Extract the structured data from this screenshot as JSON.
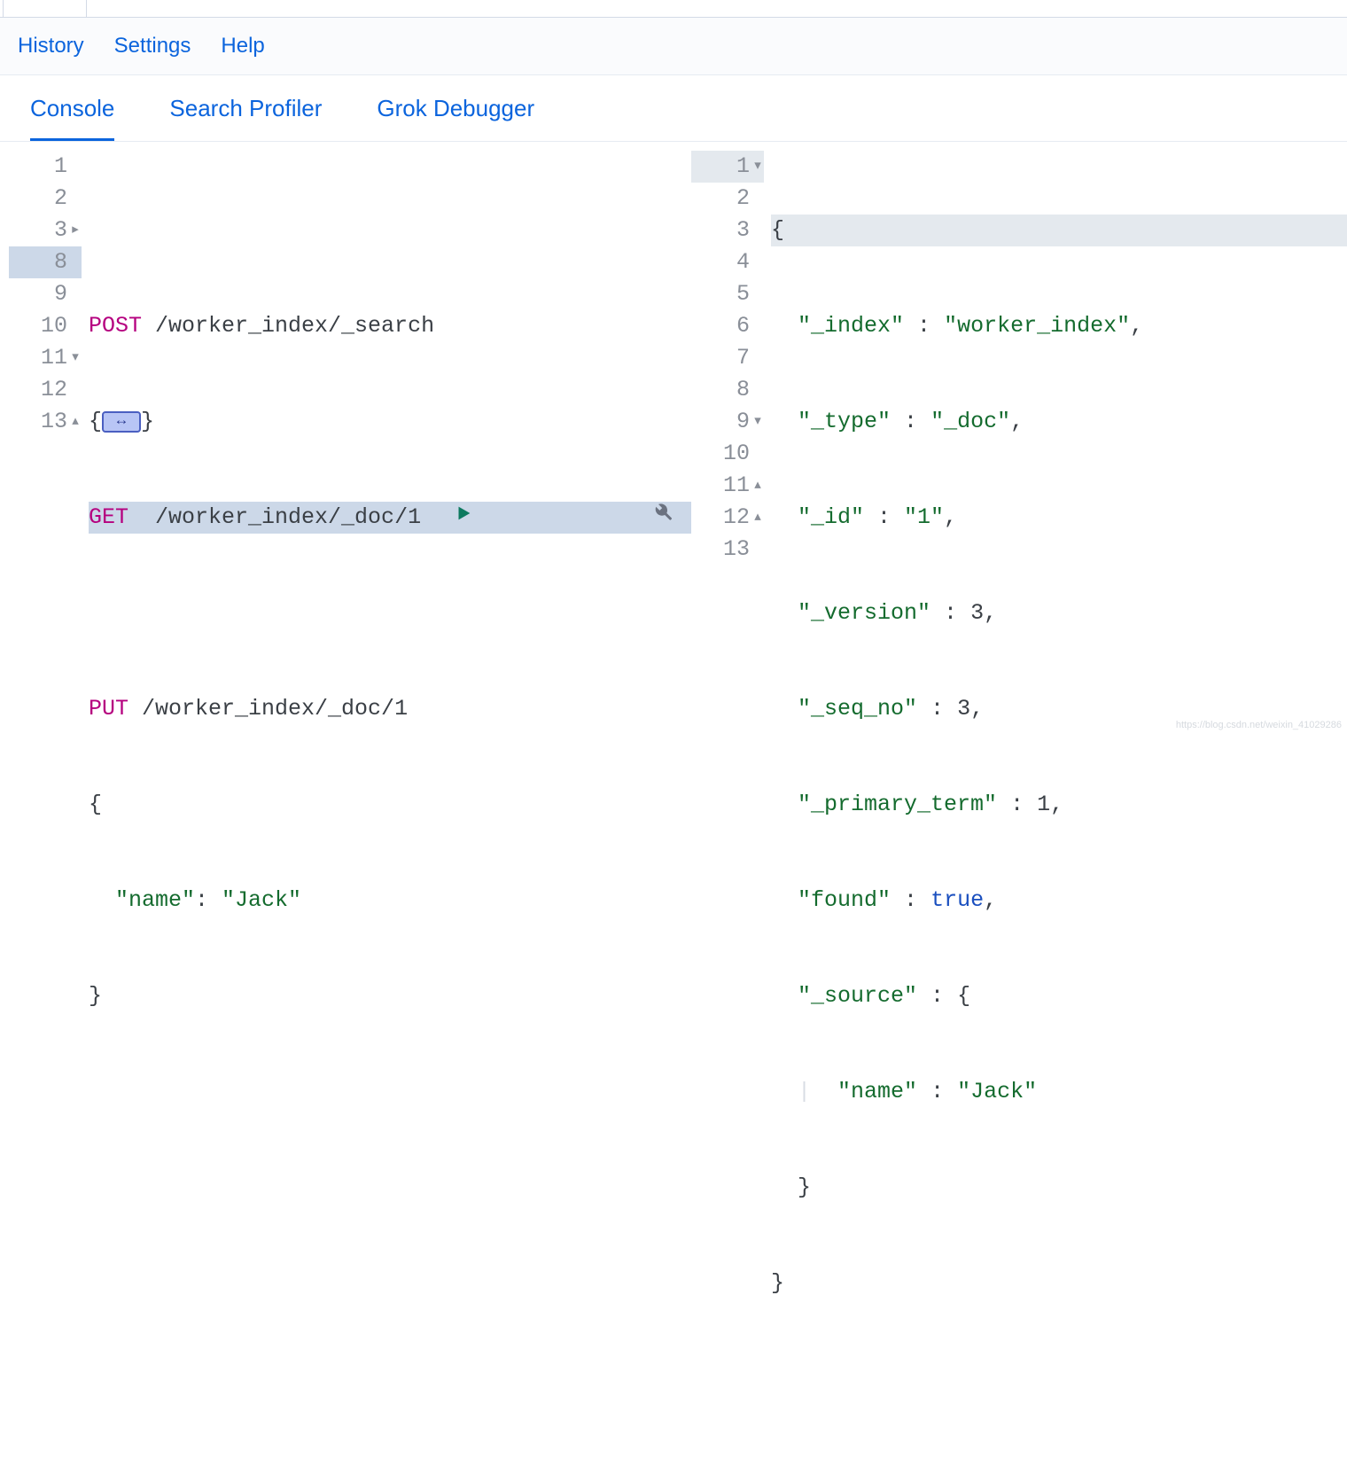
{
  "menu": {
    "history": "History",
    "settings": "Settings",
    "help": "Help"
  },
  "tabs": {
    "console": "Console",
    "profiler": "Search Profiler",
    "grok": "Grok Debugger"
  },
  "left": {
    "lines": [
      "1",
      "2",
      "3",
      "8",
      "9",
      "10",
      "11",
      "12",
      "13"
    ],
    "l2_method": "POST",
    "l2_path": " /worker_index/_search",
    "l3_open": "{",
    "l3_close": "}",
    "l8_method": "GET",
    "l8_path": "  /worker_index/_doc/1",
    "l10_method": "PUT",
    "l10_path": " /worker_index/_doc/1",
    "l11": "{",
    "l12_key": "\"name\"",
    "l12_val": "\"Jack\"",
    "l13": "}"
  },
  "right": {
    "lines": [
      "1",
      "2",
      "3",
      "4",
      "5",
      "6",
      "7",
      "8",
      "9",
      "10",
      "11",
      "12",
      "13"
    ],
    "r1": "{",
    "r2_k": "\"_index\"",
    "r2_v": "\"worker_index\"",
    "r3_k": "\"_type\"",
    "r3_v": "\"_doc\"",
    "r4_k": "\"_id\"",
    "r4_v": "\"1\"",
    "r5_k": "\"_version\"",
    "r5_v": "3",
    "r6_k": "\"_seq_no\"",
    "r6_v": "3",
    "r7_k": "\"_primary_term\"",
    "r7_v": "1",
    "r8_k": "\"found\"",
    "r8_v": "true",
    "r9_k": "\"_source\"",
    "r10_k": "\"name\"",
    "r10_v": "\"Jack\"",
    "r11": "}",
    "r12": "}"
  },
  "watermark": "https://blog.csdn.net/weixin_41029286"
}
